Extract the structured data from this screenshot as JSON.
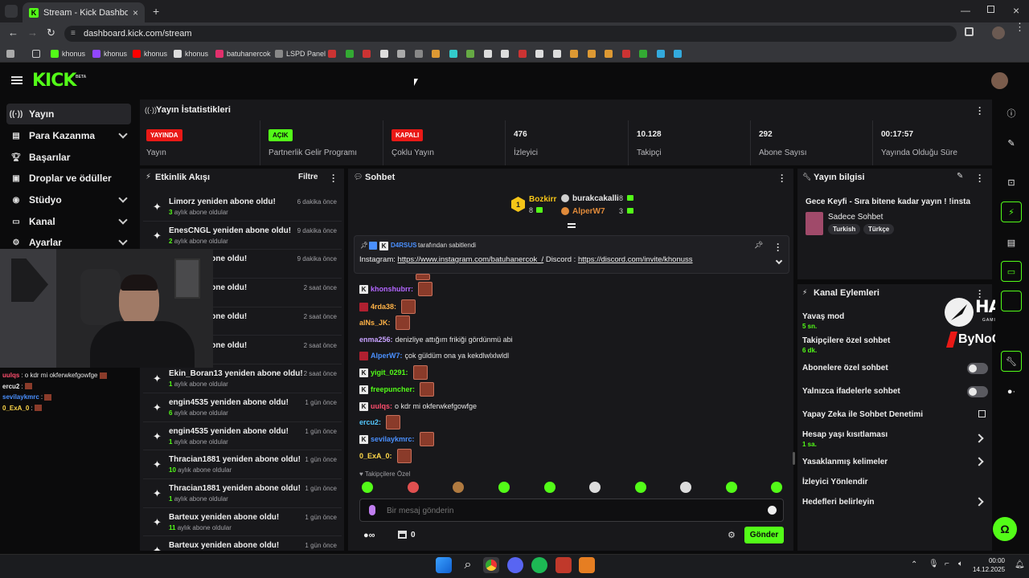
{
  "browser": {
    "tab_title": "Stream - Kick Dashboard",
    "url": "dashboard.kick.com/stream",
    "bookmarks": [
      "khonus",
      "khonus",
      "khonus",
      "khonus",
      "batuhanercok",
      "LSPD Panel"
    ]
  },
  "kick": {
    "logo": "KICK",
    "beta": "BETA"
  },
  "sidebar": {
    "items": [
      {
        "label": "Yayın",
        "icon": "broadcast-icon"
      },
      {
        "label": "Para Kazanma",
        "icon": "money-icon"
      },
      {
        "label": "Başarılar",
        "icon": "trophy-icon"
      },
      {
        "label": "Droplar ve ödüller",
        "icon": "gift-icon"
      },
      {
        "label": "Stüdyo",
        "icon": "studio-icon"
      },
      {
        "label": "Kanal",
        "icon": "channel-icon"
      },
      {
        "label": "Ayarlar",
        "icon": "gear-icon"
      }
    ]
  },
  "stats": {
    "title": "Yayın İstatistikleri",
    "items": [
      {
        "badge": "YAYINDA",
        "label": "Yayın"
      },
      {
        "badge": "AÇIK",
        "label": "Partnerlik Gelir Programı"
      },
      {
        "badge": "KAPALI",
        "label": "Çoklu Yayın"
      },
      {
        "value": "476",
        "label": "İzleyici"
      },
      {
        "value": "10.128",
        "label": "Takipçi"
      },
      {
        "value": "292",
        "label": "Abone Sayısı"
      },
      {
        "value": "00:17:57",
        "label": "Yayında Olduğu Süre"
      }
    ]
  },
  "activity": {
    "title": "Etkinlik Akışı",
    "filter": "Filtre",
    "items": [
      {
        "title": "Limorz yeniden abone oldu!",
        "n": "3",
        "sub": "aylık abone oldular",
        "time": "6 dakika önce"
      },
      {
        "title": "EnesCNGL yeniden abone oldu!",
        "n": "2",
        "sub": "aylık abone oldular",
        "time": "9 dakika önce"
      },
      {
        "title": "yeniden abone oldu!",
        "n": "",
        "sub": "",
        "time": "9 dakika önce"
      },
      {
        "title": "yeniden abone oldu!",
        "n": "",
        "sub": "",
        "time": "2 saat önce"
      },
      {
        "title": "yeniden abone oldu!",
        "n": "",
        "sub": "",
        "time": "2 saat önce"
      },
      {
        "title": "yeniden abone oldu!",
        "n": "",
        "sub": "oldular",
        "time": "2 saat önce"
      },
      {
        "title": "Ekin_Boran13 yeniden abone oldu!",
        "n": "1",
        "sub": "aylık abone oldular",
        "time": "2 saat önce"
      },
      {
        "title": "engin4535 yeniden abone oldu!",
        "n": "6",
        "sub": "aylık abone oldular",
        "time": "1 gün önce"
      },
      {
        "title": "engin4535 yeniden abone oldu!",
        "n": "1",
        "sub": "aylık abone oldular",
        "time": "1 gün önce"
      },
      {
        "title": "Thracian1881 yeniden abone oldu!",
        "n": "10",
        "sub": "aylık abone oldular",
        "time": "1 gün önce"
      },
      {
        "title": "Thracian1881 yeniden abone oldu!",
        "n": "1",
        "sub": "aylık abone oldular",
        "time": "1 gün önce"
      },
      {
        "title": "Barteux yeniden abone oldu!",
        "n": "11",
        "sub": "aylık abone oldular",
        "time": "1 gün önce"
      },
      {
        "title": "Barteux yeniden abone oldu!",
        "n": "",
        "sub": "",
        "time": "1 gün önce"
      }
    ]
  },
  "chat": {
    "title": "Sohbet",
    "leaderboard": {
      "first": {
        "name": "Bozkirr",
        "count": "8",
        "rank": "1"
      },
      "second": {
        "name": "burakcakalli",
        "count": "8"
      },
      "third": {
        "name": "AlperW7",
        "count": "3"
      }
    },
    "pinned": {
      "by_user": "D4RSUS",
      "by_text": "tarafından sabitlendi",
      "prefix": "Instagram:",
      "link1": "https://www.instagram.com/batuhanercok_/",
      "mid": "Discord :",
      "link2": "https://discord.com/invite/khonuss"
    },
    "messages": [
      {
        "user": "khonshubrr:",
        "color": "#b366ff",
        "text": ""
      },
      {
        "user": "4rda38:",
        "color": "#ffb347",
        "text": ""
      },
      {
        "user": "alNs_JK:",
        "color": "#ffb347",
        "text": ""
      },
      {
        "user": "enma256:",
        "color": "#c8a2ff",
        "text": "denizliye attığım frikiği gördünmü abi"
      },
      {
        "user": "AlperW7:",
        "color": "#4a90ff",
        "text": "çok güldüm ona ya kekdlwlxlwldl"
      },
      {
        "user": "yigit_0291:",
        "color": "#53fc18",
        "text": ""
      },
      {
        "user": "freepuncher:",
        "color": "#53fc18",
        "text": ""
      },
      {
        "user": "uulqs:",
        "color": "#ff4d6d",
        "text": "o kdr mi okferwkefgowfge"
      },
      {
        "user": "ercu2:",
        "color": "#53c8ff",
        "text": ""
      },
      {
        "user": "sevilaykmrc:",
        "color": "#4a90ff",
        "text": ""
      },
      {
        "user": "0_ExA_0:",
        "color": "#ffd84a",
        "text": ""
      }
    ],
    "followers_only": "Takipçilere Özel",
    "input_placeholder": "Bir mesaj gönderin",
    "points": "0",
    "send": "Gönder"
  },
  "overlay_chat": [
    {
      "user": "uulqs",
      "color": "#ff4d6d",
      "text": ": o kdr mi okferwkefgowfge"
    },
    {
      "user": "ercu2",
      "color": "#eee",
      "text": ":"
    },
    {
      "user": "sevilaykmrc",
      "color": "#4a90ff",
      "text": ":"
    },
    {
      "user": "0_ExA_0",
      "color": "#ffd84a",
      "text": ":"
    }
  ],
  "stream_info": {
    "title": "Yayın bilgisi",
    "stream_title": "Gece Keyfi - Sıra bitene kadar yayın ! !insta",
    "category": "Sadece Sohbet",
    "tags": [
      "Turkish",
      "Türkçe"
    ]
  },
  "channel_actions": {
    "title": "Kanal Eylemleri",
    "items": [
      {
        "label": "Yavaş mod",
        "sub": "5 sn."
      },
      {
        "label": "Takipçilere özel sohbet",
        "sub": "6 dk."
      },
      {
        "label": "Abonelere özel sohbet",
        "sub": ""
      },
      {
        "label": "Yalnızca ifadelerle sohbet",
        "sub": ""
      },
      {
        "label": "Yapay Zeka ile Sohbet Denetimi",
        "sub": ""
      },
      {
        "label": "Hesap yaşı kısıtlaması",
        "sub": "1 sa."
      },
      {
        "label": "Yasaklanmış kelimeler",
        "sub": ""
      },
      {
        "label": "İzleyici Yönlendir",
        "sub": ""
      },
      {
        "label": "Hedefleri belirleyin",
        "sub": ""
      }
    ]
  },
  "sponsor": {
    "hawk": "HAWK",
    "hawk_sub": "GAMING CHAIR",
    "bynogame": "ByNoGame"
  },
  "taskbar": {
    "time": "00:00",
    "date": "14.12.2025"
  },
  "colors": {
    "accent": "#53fc18",
    "panel": "#18181b",
    "bg": "#0b0b0c",
    "live": "#e91916"
  }
}
